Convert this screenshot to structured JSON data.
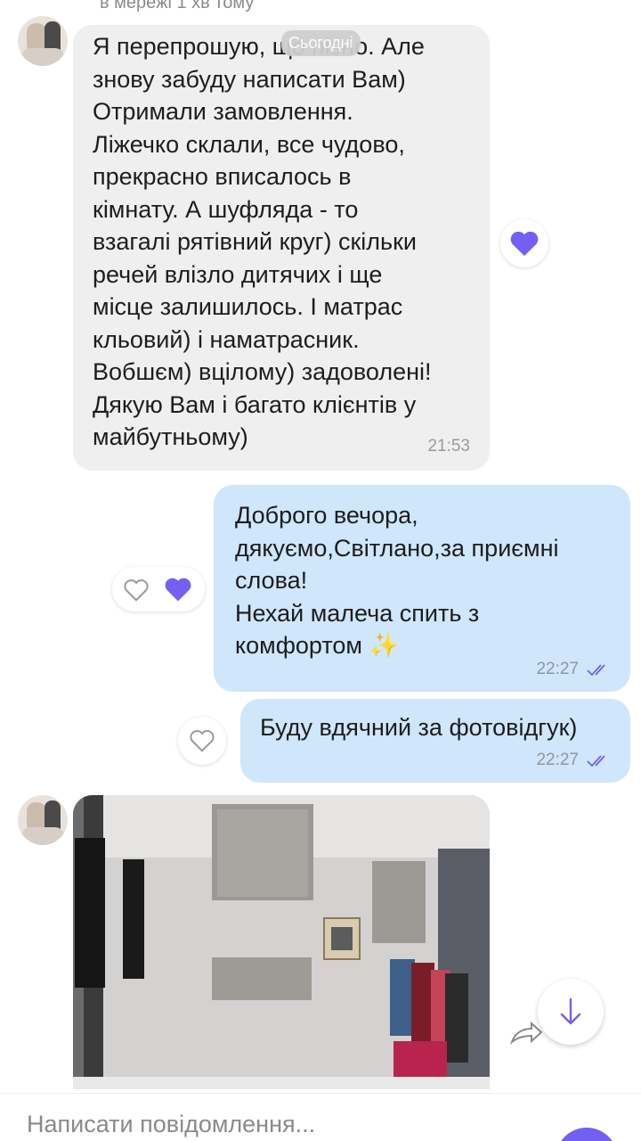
{
  "header": {
    "status": "в мережі 1 хв тому"
  },
  "date_separator": "Сьогодні",
  "messages": [
    {
      "direction": "incoming",
      "text": "Я перепрошую, що пізно. Але\nзнову забуду написати Вам)\nОтримали замовлення.\nЛіжечко склали, все чудово,\nпрекрасно вписалось в\nкімнату. А шуфляда - то\nвзагалі рятівний круг) скільки\nречей влізло дитячих і ще\nмісце залишилось. І матрас\nкльовий) і наматрасник.\nВобшєм) вцілому) задоволені!\nДякую Вам і багато клієнтів у\nмайбутньому)",
      "time": "21:53",
      "reaction": "heart-filled"
    },
    {
      "direction": "outgoing",
      "text": "Доброго вечора,\nдякуємо,Світлано,за приємні\nслова!\nНехай малеча спить з\nкомфортом ✨",
      "time": "22:27",
      "status": "read"
    },
    {
      "direction": "outgoing",
      "text": "Буду вдячний за фотовідгук)",
      "time": "22:27",
      "status": "read"
    }
  ],
  "composer": {
    "placeholder": "Написати повідомлення..."
  },
  "colors": {
    "accent": "#7360f2",
    "outgoing_bubble": "#cfe6fb",
    "incoming_bubble": "#efefef"
  }
}
